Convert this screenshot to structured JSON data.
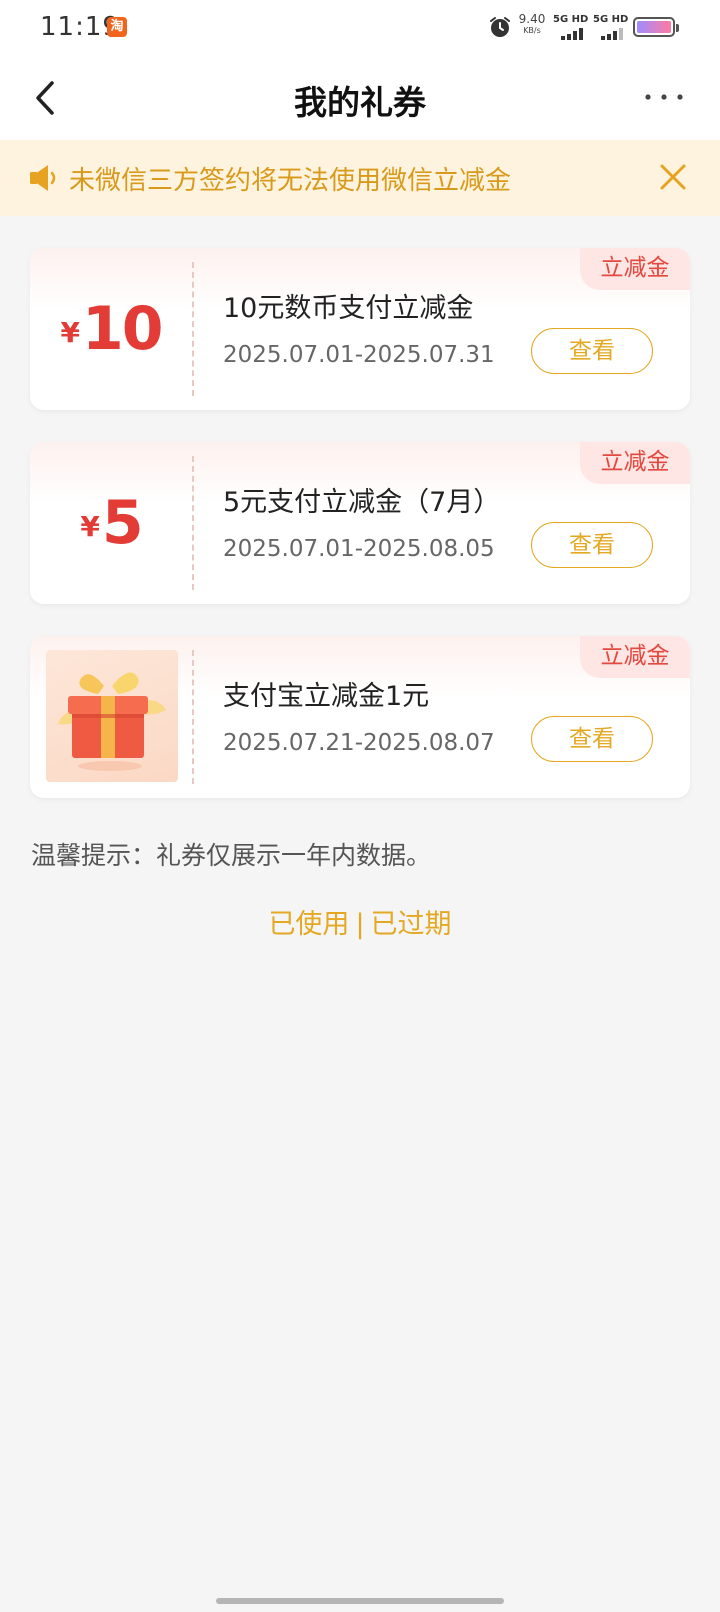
{
  "status_bar": {
    "time": "11:19",
    "app_badge": "淘",
    "net_speed_value": "9.40",
    "net_speed_unit": "KB/s",
    "sim1_label": "5G HD",
    "sim2_label": "5G HD"
  },
  "nav": {
    "title": "我的礼券"
  },
  "notice": {
    "text": "未微信三方签约将无法使用微信立减金"
  },
  "coupons": [
    {
      "tag": "立减金",
      "currency": "¥",
      "amount": "10",
      "name": "10元数币支付立减金",
      "date_range": "2025.07.01-2025.07.31",
      "button_label": "查看"
    },
    {
      "tag": "立减金",
      "currency": "¥",
      "amount": "5",
      "name": "5元支付立减金（7月）",
      "date_range": "2025.07.01-2025.08.05",
      "button_label": "查看"
    },
    {
      "tag": "立减金",
      "image": "gift-box-icon",
      "name": "支付宝立减金1元",
      "date_range": "2025.07.21-2025.08.07",
      "button_label": "查看"
    }
  ],
  "tip": "温馨提示：礼券仅展示一年内数据。",
  "history": {
    "used_label": "已使用",
    "separator": "|",
    "expired_label": "已过期"
  },
  "colors": {
    "accent": "#e4a823",
    "amount_red": "#e33b35",
    "notice_bg": "#fdf3df",
    "notice_text": "#d99a1c",
    "page_bg": "#f5f5f5"
  }
}
